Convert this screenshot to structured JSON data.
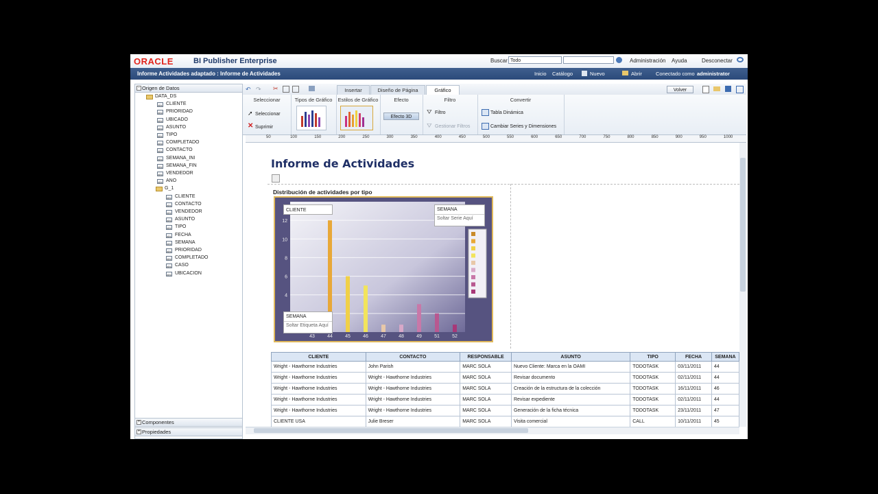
{
  "header": {
    "brand": "ORACLE",
    "product": "BI Publisher Enterprise",
    "search_label": "Buscar",
    "search_scope": "Todo",
    "links": [
      "Administración",
      "Ayuda",
      "Desconectar"
    ]
  },
  "nav": {
    "breadcrumb": "Informe Actividades adaptado : Informe de Actividades",
    "inicio": "Inicio",
    "catalogo": "Catálogo",
    "nuevo": "Nuevo",
    "abrir": "Abrir",
    "conectado": "Conectado como",
    "user": "administrator"
  },
  "left_panel": {
    "title": "Origen de Datos",
    "root": "DATA_DS",
    "fields": [
      "CLIENTE",
      "PRIORIDAD",
      "UBICADO",
      "ASUNTO",
      "TIPO",
      "COMPLETADO",
      "CONTACTO",
      "SEMANA_INI",
      "SEMANA_FIN",
      "VENDEDOR",
      "ANO"
    ],
    "group": "G_1",
    "group_fields": [
      "CLIENTE",
      "CONTACTO",
      "VENDEDOR",
      "ASUNTO",
      "TIPO",
      "FECHA",
      "SEMANA",
      "PRIORIDAD",
      "COMPLETADO",
      "CASO",
      "UBICACION"
    ],
    "componentes": "Componentes",
    "propiedades": "Propiedades"
  },
  "tabs": [
    "Insertar",
    "Diseño de Página",
    "Gráfico"
  ],
  "volver": "Volver",
  "ribbon": {
    "groups": [
      "Seleccionar",
      "Tipos de Gráfico",
      "Estilos de Gráfico",
      "Efecto",
      "Filtro",
      "Convertir"
    ],
    "seleccionar": "Seleccionar",
    "suprimir": "Suprimir",
    "efecto3d": "Efecto 3D",
    "filtro": "Filtro",
    "gestionar_filtros": "Gestionar Filtros",
    "tabla_dinamica": "Tabla Dinámica",
    "cambiar_series": "Cambiar Series y Dimensiones"
  },
  "ruler": [
    "50",
    "100",
    "150",
    "200",
    "250",
    "300",
    "350",
    "400",
    "450",
    "500",
    "550",
    "600",
    "650",
    "700",
    "750",
    "800",
    "850",
    "900",
    "950",
    "1000"
  ],
  "report": {
    "title": "Informe de Actividades",
    "chart_title": "Distribución de actividades por tipo",
    "drop_cliente": "CLIENTE",
    "drop_semana_series": "SEMANA",
    "drop_series_hint": "Soltar Serie Aquí",
    "drop_semana_label": "SEMANA",
    "drop_label_hint": "Soltar Etiqueta Aquí"
  },
  "chart_data": {
    "type": "bar",
    "categories": [
      "43",
      "44",
      "45",
      "46",
      "47",
      "48",
      "49",
      "51",
      "52"
    ],
    "values": [
      0.5,
      12,
      6,
      5,
      0.8,
      0.8,
      3,
      2,
      0.8
    ],
    "yticks": [
      "2",
      "4",
      "6",
      "8",
      "10",
      "12"
    ],
    "ylim": [
      0,
      14
    ],
    "colors": [
      "#c98a2a",
      "#e8a838",
      "#f0d048",
      "#f2e45c",
      "#e8c8a8",
      "#d8a8c8",
      "#c878a8",
      "#b85890",
      "#a83878"
    ]
  },
  "table": {
    "headers": [
      "CLIENTE",
      "CONTACTO",
      "RESPONSABLE",
      "ASUNTO",
      "TIPO",
      "FECHA",
      "SEMANA"
    ],
    "rows": [
      [
        "Wright - Hawthorne Industries",
        "John Parish",
        "MARC SOLA",
        "Nuevo Cliente: Marca en la OAMI",
        "TODOTASK",
        "03/11/2011",
        "44"
      ],
      [
        "Wright - Hawthorne Industries",
        "Wright - Hawthorne Industries",
        "MARC SOLA",
        "Revisar documento",
        "TODOTASK",
        "02/11/2011",
        "44"
      ],
      [
        "Wright - Hawthorne Industries",
        "Wright - Hawthorne Industries",
        "MARC SOLA",
        "Creación de la estructura de la colección",
        "TODOTASK",
        "16/11/2011",
        "46"
      ],
      [
        "Wright - Hawthorne Industries",
        "Wright - Hawthorne Industries",
        "MARC SOLA",
        "Revisar expediente",
        "TODOTASK",
        "02/11/2011",
        "44"
      ],
      [
        "Wright - Hawthorne Industries",
        "Wright - Hawthorne Industries",
        "MARC SOLA",
        "Generación de la ficha técnica",
        "TODOTASK",
        "23/11/2011",
        "47"
      ],
      [
        "CLIENTE USA",
        "Julie Breser",
        "MARC SOLA",
        "Visita comercial",
        "CALL",
        "10/11/2011",
        "45"
      ]
    ]
  }
}
